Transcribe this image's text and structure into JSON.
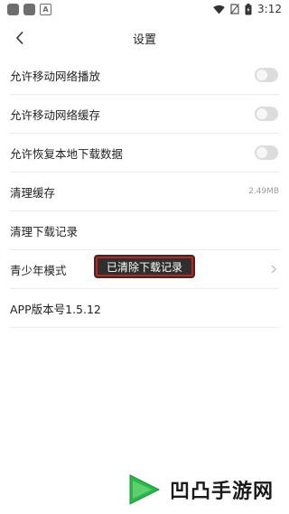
{
  "status_bar": {
    "time": "3:12",
    "a_icon": "A"
  },
  "header": {
    "title": "设置"
  },
  "settings": {
    "mobile_play": {
      "label": "允许移动网络播放",
      "on": false
    },
    "mobile_cache": {
      "label": "允许移动网络缓存",
      "on": false
    },
    "restore_local": {
      "label": "允许恢复本地下载数据",
      "on": false
    },
    "clear_cache": {
      "label": "清理缓存",
      "value": "2.49MB"
    },
    "clear_downloads": {
      "label": "清理下载记录"
    },
    "youth_mode": {
      "label": "青少年模式"
    },
    "app_version": {
      "label": "APP版本号1.5.12"
    }
  },
  "toast": {
    "text": "已清除下载记录",
    "highlight_color": "#d11a1a"
  },
  "watermark": {
    "text": "凹凸手游网"
  },
  "colors": {
    "toggle_off": "#dcdcdc",
    "toast_bg": "#2f2f2f"
  }
}
